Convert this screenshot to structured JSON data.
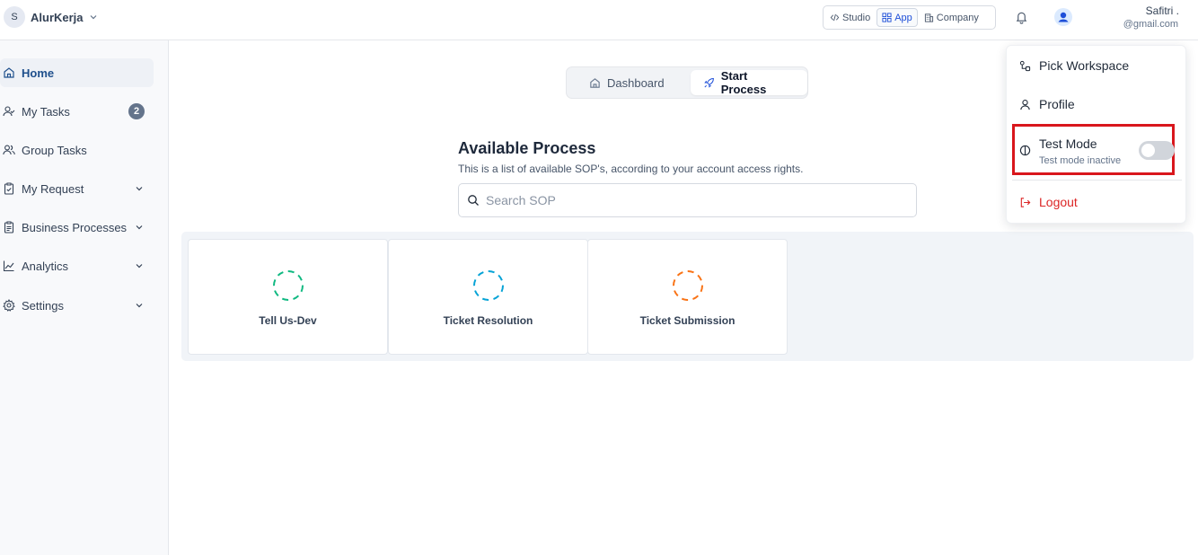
{
  "workspace": {
    "initial": "S",
    "name": "AlurKerja"
  },
  "modes": [
    {
      "label": "Studio",
      "icon": "code-icon",
      "active": false
    },
    {
      "label": "App",
      "icon": "grid-icon",
      "active": true
    },
    {
      "label": "Company",
      "icon": "building-icon",
      "active": false
    }
  ],
  "user": {
    "name": "Safitri .",
    "email": "@gmail.com"
  },
  "sidebar": {
    "items": [
      {
        "label": "Home",
        "icon": "home-icon",
        "active": true
      },
      {
        "label": "My Tasks",
        "icon": "user-check-icon",
        "badge": "2"
      },
      {
        "label": "Group Tasks",
        "icon": "users-icon"
      },
      {
        "label": "My Request",
        "icon": "clipboard-check-icon",
        "expandable": true
      },
      {
        "label": "Business Processes",
        "icon": "clipboard-list-icon",
        "expandable": true
      },
      {
        "label": "Analytics",
        "icon": "line-chart-icon",
        "expandable": true
      },
      {
        "label": "Settings",
        "icon": "gear-icon",
        "expandable": true
      }
    ]
  },
  "tabs": {
    "dashboard": "Dashboard",
    "start_process": "Start Process",
    "active": "start_process"
  },
  "main": {
    "title": "Available Process",
    "subtitle": "This is a list of available SOP's, according to your account access rights.",
    "search_placeholder": "Search SOP",
    "processes": [
      {
        "label": "Tell Us-Dev",
        "color": "#10b981"
      },
      {
        "label": "Ticket Resolution",
        "color": "#06a3d6"
      },
      {
        "label": "Ticket Submission",
        "color": "#f97316"
      }
    ]
  },
  "menu": {
    "pick_workspace": "Pick Workspace",
    "profile": "Profile",
    "test_mode_title": "Test Mode",
    "test_mode_status": "Test mode inactive",
    "test_mode_enabled": false,
    "logout": "Logout",
    "highlight_color": "#d9161c"
  }
}
